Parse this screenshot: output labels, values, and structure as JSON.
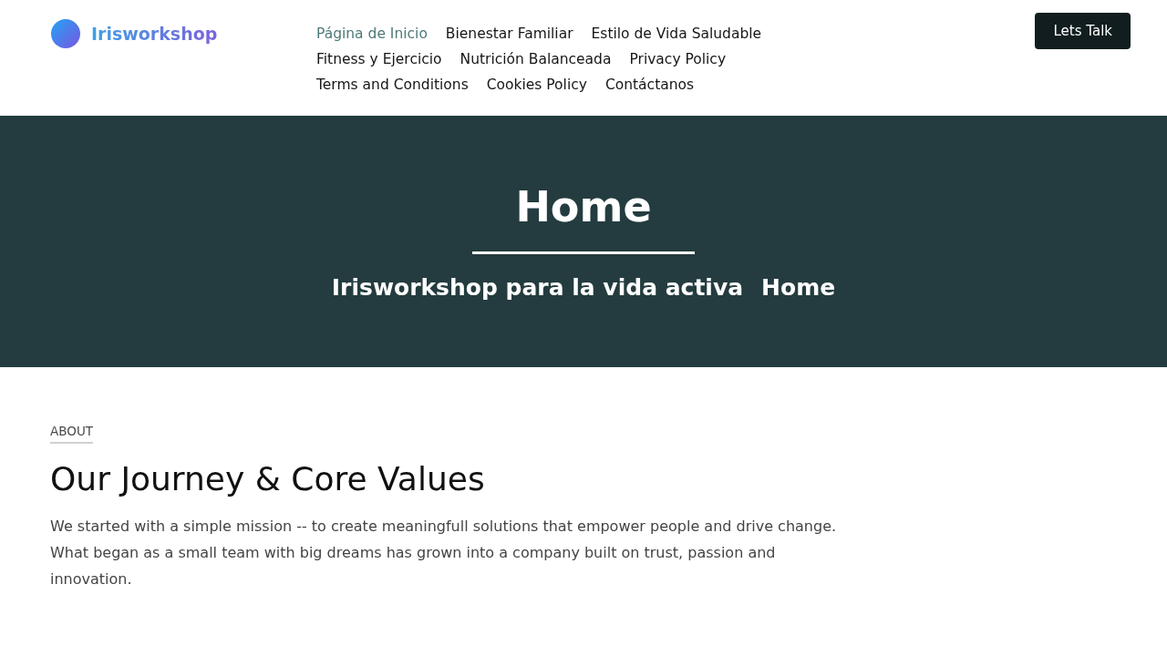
{
  "header": {
    "logo": {
      "text": "Irisworkshop"
    },
    "nav": [
      {
        "label": "Página de Inicio",
        "selected": true
      },
      {
        "label": "Bienestar Familiar",
        "selected": false
      },
      {
        "label": "Estilo de Vida Saludable",
        "selected": false
      },
      {
        "label": "Fitness y Ejercicio",
        "selected": false
      },
      {
        "label": "Nutrición Balanceada",
        "selected": false
      },
      {
        "label": "Privacy Policy",
        "selected": false
      },
      {
        "label": "Terms and Conditions",
        "selected": false
      },
      {
        "label": "Cookies Policy",
        "selected": false
      },
      {
        "label": "Contáctanos",
        "selected": false
      }
    ],
    "cta": "Lets Talk"
  },
  "hero": {
    "title": "Home",
    "breadcrumb": [
      "Irisworkshop para la vida activa",
      "Home"
    ]
  },
  "about": {
    "eyebrow": "ABOUT",
    "heading": "Our Journey & Core Values",
    "paragraph": "We started with a simple mission -- to create meaningfull solutions that empower people and drive change. What began as a small team with big dreams has grown into a company built on trust, passion and innovation."
  }
}
